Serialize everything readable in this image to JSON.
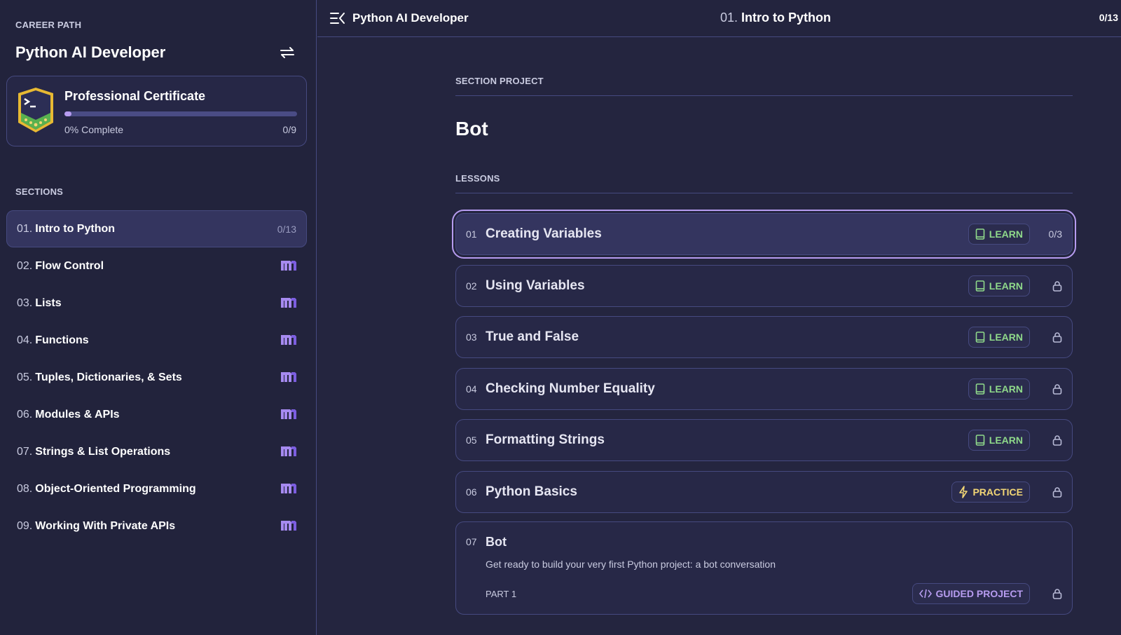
{
  "sidebar": {
    "caption": "CAREER PATH",
    "title": "Python AI Developer",
    "certificate": {
      "title": "Professional Certificate",
      "progress_percent": 0,
      "progress_label": "0% Complete",
      "count": "0/9"
    },
    "sections_caption": "SECTIONS",
    "sections": [
      {
        "num": "01.",
        "label": "Intro to Python",
        "status": "0/13",
        "active": true
      },
      {
        "num": "02.",
        "label": "Flow Control",
        "icon": "module-icon"
      },
      {
        "num": "03.",
        "label": "Lists",
        "icon": "module-icon"
      },
      {
        "num": "04.",
        "label": "Functions",
        "icon": "module-icon"
      },
      {
        "num": "05.",
        "label": "Tuples, Dictionaries, & Sets",
        "icon": "module-icon"
      },
      {
        "num": "06.",
        "label": "Modules & APIs",
        "icon": "module-icon"
      },
      {
        "num": "07.",
        "label": "Strings & List Operations",
        "icon": "module-icon"
      },
      {
        "num": "08.",
        "label": "Object-Oriented Programming",
        "icon": "module-icon"
      },
      {
        "num": "09.",
        "label": "Working With Private APIs",
        "icon": "module-icon"
      }
    ]
  },
  "header": {
    "title": "Python AI Developer",
    "section_num": "01.",
    "section_title": "Intro to Python",
    "count": "0/13"
  },
  "main": {
    "section_caption": "SECTION PROJECT",
    "project_title": "Bot",
    "lessons_caption": "LESSONS",
    "lessons": [
      {
        "num": "01",
        "title": "Creating Variables",
        "type": "LEARN",
        "status": "0/3"
      },
      {
        "num": "02",
        "title": "Using Variables",
        "type": "LEARN",
        "status": "locked"
      },
      {
        "num": "03",
        "title": "True and False",
        "type": "LEARN",
        "status": "locked"
      },
      {
        "num": "04",
        "title": "Checking Number Equality",
        "type": "LEARN",
        "status": "locked"
      },
      {
        "num": "05",
        "title": "Formatting Strings",
        "type": "LEARN",
        "status": "locked"
      },
      {
        "num": "06",
        "title": "Python Basics",
        "type": "PRACTICE",
        "status": "locked"
      }
    ],
    "project": {
      "num": "07",
      "title": "Bot",
      "description": "Get ready to build your very first Python project: a bot conversation",
      "part": "PART 1",
      "type": "GUIDED PROJECT",
      "status": "locked"
    }
  },
  "colors": {
    "background": "#24253f",
    "accent": "#b79cf0",
    "learn": "#8fd98a",
    "practice": "#f2d675"
  }
}
